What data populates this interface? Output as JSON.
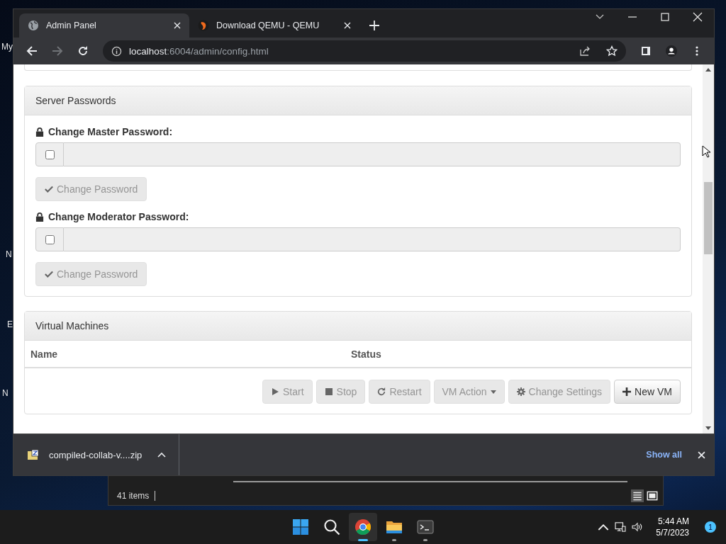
{
  "desktop_labels": [
    "My",
    "N",
    "E",
    "N"
  ],
  "browser": {
    "tabs": [
      {
        "title": "Admin Panel",
        "kind": "globe",
        "selected": true
      },
      {
        "title": "Download QEMU - QEMU",
        "kind": "qemu",
        "selected": false
      }
    ],
    "url_host": "localhost",
    "url_rest": ":6004/admin/config.html"
  },
  "password_panel": {
    "title": "Server Passwords",
    "fields": [
      {
        "label": "Change Master Password:",
        "checked": false,
        "button": "Change Password",
        "button_disabled": true
      },
      {
        "label": "Change Moderator Password:",
        "checked": false,
        "button": "Change Password",
        "button_disabled": true
      }
    ]
  },
  "vm_panel": {
    "title": "Virtual Machines",
    "columns": [
      "Name",
      "Status"
    ],
    "buttons": [
      {
        "label": "Start",
        "kind": "play",
        "disabled": true
      },
      {
        "label": "Stop",
        "kind": "stop",
        "disabled": true
      },
      {
        "label": "Restart",
        "kind": "refresh",
        "disabled": true
      },
      {
        "label": "VM Action",
        "kind": "caret",
        "disabled": true
      },
      {
        "label": "Change Settings",
        "kind": "gear",
        "disabled": true
      },
      {
        "label": "New VM",
        "kind": "plus",
        "disabled": false
      }
    ]
  },
  "download_bar": {
    "file": "compiled-collab-v....zip",
    "show_all": "Show all"
  },
  "explorer": {
    "status": "41 items"
  },
  "taskbar": {
    "apps": [
      {
        "kind": "start"
      },
      {
        "kind": "search"
      },
      {
        "kind": "chrome",
        "active": true,
        "running": true
      },
      {
        "kind": "folder",
        "active": false,
        "running": true
      },
      {
        "kind": "terminal",
        "active": false,
        "running": true
      }
    ],
    "time": "5:44 AM",
    "date": "5/7/2023",
    "notifications": "1"
  }
}
